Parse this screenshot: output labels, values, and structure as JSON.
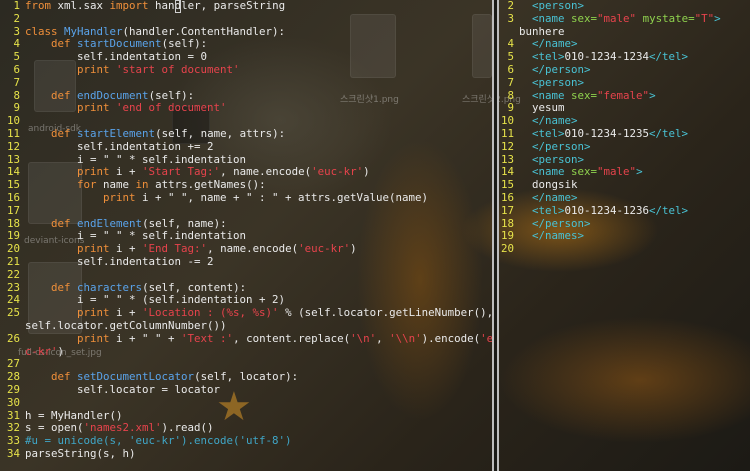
{
  "desktop": {
    "labels": [
      "스크린샷1.png",
      "스크린샷2.png",
      "android-sdk",
      "deviant-icons",
      "full-cs-icon_set.jpg"
    ]
  },
  "left_pane": {
    "lines": [
      {
        "n": "1",
        "parts": [
          [
            "kw",
            "from"
          ],
          [
            "plain",
            " xml.sax "
          ],
          [
            "kw",
            "import"
          ],
          [
            "plain",
            " han"
          ],
          [
            "cursor",
            "d"
          ],
          [
            "plain",
            "ler, parseString"
          ]
        ]
      },
      {
        "n": "2",
        "parts": []
      },
      {
        "n": "3",
        "parts": [
          [
            "kw",
            "class"
          ],
          [
            "plain",
            " "
          ],
          [
            "fn",
            "MyHandler"
          ],
          [
            "plain",
            "(handler.ContentHandler):"
          ]
        ]
      },
      {
        "n": "4",
        "parts": [
          [
            "plain",
            "    "
          ],
          [
            "kw",
            "def"
          ],
          [
            "plain",
            " "
          ],
          [
            "fn",
            "startDocument"
          ],
          [
            "plain",
            "(self):"
          ]
        ]
      },
      {
        "n": "5",
        "parts": [
          [
            "plain",
            "        self.indentation = 0"
          ]
        ]
      },
      {
        "n": "6",
        "parts": [
          [
            "plain",
            "        "
          ],
          [
            "kw",
            "print"
          ],
          [
            "plain",
            " "
          ],
          [
            "strs",
            "'start of document'"
          ]
        ]
      },
      {
        "n": "7",
        "parts": []
      },
      {
        "n": "8",
        "parts": [
          [
            "plain",
            "    "
          ],
          [
            "kw",
            "def"
          ],
          [
            "plain",
            " "
          ],
          [
            "fn",
            "endDocument"
          ],
          [
            "plain",
            "(self):"
          ]
        ]
      },
      {
        "n": "9",
        "parts": [
          [
            "plain",
            "        "
          ],
          [
            "kw",
            "print"
          ],
          [
            "plain",
            " "
          ],
          [
            "strs",
            "'end of document'"
          ]
        ]
      },
      {
        "n": "10",
        "parts": []
      },
      {
        "n": "11",
        "parts": [
          [
            "plain",
            "    "
          ],
          [
            "kw",
            "def"
          ],
          [
            "plain",
            " "
          ],
          [
            "fn",
            "startElement"
          ],
          [
            "plain",
            "(self, name, attrs):"
          ]
        ]
      },
      {
        "n": "12",
        "parts": [
          [
            "plain",
            "        self.indentation += 2"
          ]
        ]
      },
      {
        "n": "13",
        "parts": [
          [
            "plain",
            "        i = \" \" * self.indentation"
          ]
        ]
      },
      {
        "n": "14",
        "parts": [
          [
            "plain",
            "        "
          ],
          [
            "kw",
            "print"
          ],
          [
            "plain",
            " i + "
          ],
          [
            "strs",
            "'Start Tag:'"
          ],
          [
            "plain",
            ", name.encode("
          ],
          [
            "strs",
            "'euc-kr'"
          ],
          [
            "plain",
            ")"
          ]
        ]
      },
      {
        "n": "15",
        "parts": [
          [
            "plain",
            "        "
          ],
          [
            "kw",
            "for"
          ],
          [
            "plain",
            " name "
          ],
          [
            "kw",
            "in"
          ],
          [
            "plain",
            " attrs.getNames():"
          ]
        ]
      },
      {
        "n": "16",
        "parts": [
          [
            "plain",
            "            "
          ],
          [
            "kw",
            "print"
          ],
          [
            "plain",
            " i + \" \", name + \" : \" + attrs.getValue(name)"
          ]
        ]
      },
      {
        "n": "17",
        "parts": []
      },
      {
        "n": "18",
        "parts": [
          [
            "plain",
            "    "
          ],
          [
            "kw",
            "def"
          ],
          [
            "plain",
            " "
          ],
          [
            "fn",
            "endElement"
          ],
          [
            "plain",
            "(self, name):"
          ]
        ]
      },
      {
        "n": "19",
        "parts": [
          [
            "plain",
            "        i = \" \" * self.indentation"
          ]
        ]
      },
      {
        "n": "20",
        "parts": [
          [
            "plain",
            "        "
          ],
          [
            "kw",
            "print"
          ],
          [
            "plain",
            " i + "
          ],
          [
            "strs",
            "'End Tag:'"
          ],
          [
            "plain",
            ", name.encode("
          ],
          [
            "strs",
            "'euc-kr'"
          ],
          [
            "plain",
            ")"
          ]
        ]
      },
      {
        "n": "21",
        "parts": [
          [
            "plain",
            "        self.indentation -= 2"
          ]
        ]
      },
      {
        "n": "22",
        "parts": []
      },
      {
        "n": "23",
        "parts": [
          [
            "plain",
            "    "
          ],
          [
            "kw",
            "def"
          ],
          [
            "plain",
            " "
          ],
          [
            "fn",
            "characters"
          ],
          [
            "plain",
            "(self, content):"
          ]
        ]
      },
      {
        "n": "24",
        "parts": [
          [
            "plain",
            "        i = \" \" * (self.indentation + 2)"
          ]
        ]
      },
      {
        "n": "25",
        "parts": [
          [
            "plain",
            "        "
          ],
          [
            "kw",
            "print"
          ],
          [
            "plain",
            " i + "
          ],
          [
            "strs",
            "'Location : (%s, %s)'"
          ],
          [
            "plain",
            " % (self.locator.getLineNumber(),"
          ]
        ]
      },
      {
        "n": "",
        "parts": [
          [
            "plain",
            "self.locator.getColumnNumber())"
          ]
        ]
      },
      {
        "n": "26",
        "parts": [
          [
            "plain",
            "        "
          ],
          [
            "kw",
            "print"
          ],
          [
            "plain",
            " i + \" \" + "
          ],
          [
            "strs",
            "'Text :'"
          ],
          [
            "plain",
            ", content.replace("
          ],
          [
            "strs",
            "'\\n'"
          ],
          [
            "plain",
            ", "
          ],
          [
            "strs",
            "'\\\\n'"
          ],
          [
            "plain",
            ").encode("
          ],
          [
            "strs",
            "'eu"
          ]
        ]
      },
      {
        "n": "",
        "parts": [
          [
            "strs",
            "c-kr'"
          ],
          [
            "plain",
            ")"
          ]
        ]
      },
      {
        "n": "27",
        "parts": []
      },
      {
        "n": "28",
        "parts": [
          [
            "plain",
            "    "
          ],
          [
            "kw",
            "def"
          ],
          [
            "plain",
            " "
          ],
          [
            "fn",
            "setDocumentLocator"
          ],
          [
            "plain",
            "(self, locator):"
          ]
        ]
      },
      {
        "n": "29",
        "parts": [
          [
            "plain",
            "        self.locator = locator"
          ]
        ]
      },
      {
        "n": "30",
        "parts": []
      },
      {
        "n": "31",
        "parts": [
          [
            "plain",
            "h = MyHandler()"
          ]
        ]
      },
      {
        "n": "32",
        "parts": [
          [
            "plain",
            "s = open("
          ],
          [
            "strs",
            "'names2.xml'"
          ],
          [
            "plain",
            ").read()"
          ]
        ]
      },
      {
        "n": "33",
        "parts": [
          [
            "cm",
            "#u = unicode(s, 'euc-kr').encode('utf-8')"
          ]
        ]
      },
      {
        "n": "34",
        "parts": [
          [
            "plain",
            "parseString(s, h)"
          ]
        ]
      }
    ]
  },
  "right_pane": {
    "lines": [
      {
        "n": "2",
        "parts": [
          [
            "plain",
            "  "
          ],
          [
            "tag",
            "<person>"
          ]
        ]
      },
      {
        "n": "3",
        "parts": [
          [
            "plain",
            "  "
          ],
          [
            "tag",
            "<name "
          ],
          [
            "attr",
            "sex="
          ],
          [
            "aval",
            "\"male\""
          ],
          [
            "plain",
            " "
          ],
          [
            "attr",
            "mystate="
          ],
          [
            "aval",
            "\"T\""
          ],
          [
            "tag",
            ">"
          ]
        ]
      },
      {
        "n": "",
        "parts": [
          [
            "plain",
            "bunhere"
          ]
        ]
      },
      {
        "n": "4",
        "parts": [
          [
            "plain",
            "  "
          ],
          [
            "tag",
            "</name>"
          ]
        ]
      },
      {
        "n": "5",
        "parts": [
          [
            "plain",
            "  "
          ],
          [
            "tag",
            "<tel>"
          ],
          [
            "plain",
            "010-1234-1234"
          ],
          [
            "tag",
            "</tel>"
          ]
        ]
      },
      {
        "n": "6",
        "parts": [
          [
            "plain",
            "  "
          ],
          [
            "tag",
            "</person>"
          ]
        ]
      },
      {
        "n": "7",
        "parts": [
          [
            "plain",
            "  "
          ],
          [
            "tag",
            "<person>"
          ]
        ]
      },
      {
        "n": "8",
        "parts": [
          [
            "plain",
            "  "
          ],
          [
            "tag",
            "<name "
          ],
          [
            "attr",
            "sex="
          ],
          [
            "aval",
            "\"female\""
          ],
          [
            "tag",
            ">"
          ]
        ]
      },
      {
        "n": "9",
        "parts": [
          [
            "plain",
            "  yesum"
          ]
        ]
      },
      {
        "n": "10",
        "parts": [
          [
            "plain",
            "  "
          ],
          [
            "tag",
            "</name>"
          ]
        ]
      },
      {
        "n": "11",
        "parts": [
          [
            "plain",
            "  "
          ],
          [
            "tag",
            "<tel>"
          ],
          [
            "plain",
            "010-1234-1235"
          ],
          [
            "tag",
            "</tel>"
          ]
        ]
      },
      {
        "n": "12",
        "parts": [
          [
            "plain",
            "  "
          ],
          [
            "tag",
            "</person>"
          ]
        ]
      },
      {
        "n": "13",
        "parts": [
          [
            "plain",
            "  "
          ],
          [
            "tag",
            "<person>"
          ]
        ]
      },
      {
        "n": "14",
        "parts": [
          [
            "plain",
            "  "
          ],
          [
            "tag",
            "<name "
          ],
          [
            "attr",
            "sex="
          ],
          [
            "aval",
            "\"male\""
          ],
          [
            "tag",
            ">"
          ]
        ]
      },
      {
        "n": "15",
        "parts": [
          [
            "plain",
            "  dongsik"
          ]
        ]
      },
      {
        "n": "16",
        "parts": [
          [
            "plain",
            "  "
          ],
          [
            "tag",
            "</name>"
          ]
        ]
      },
      {
        "n": "17",
        "parts": [
          [
            "plain",
            "  "
          ],
          [
            "tag",
            "<tel>"
          ],
          [
            "plain",
            "010-1234-1236"
          ],
          [
            "tag",
            "</tel>"
          ]
        ]
      },
      {
        "n": "18",
        "parts": [
          [
            "plain",
            "  "
          ],
          [
            "tag",
            "</person>"
          ]
        ]
      },
      {
        "n": "19",
        "parts": [
          [
            "plain",
            "  "
          ],
          [
            "tag",
            "</names>"
          ]
        ]
      },
      {
        "n": "20",
        "parts": []
      }
    ]
  }
}
